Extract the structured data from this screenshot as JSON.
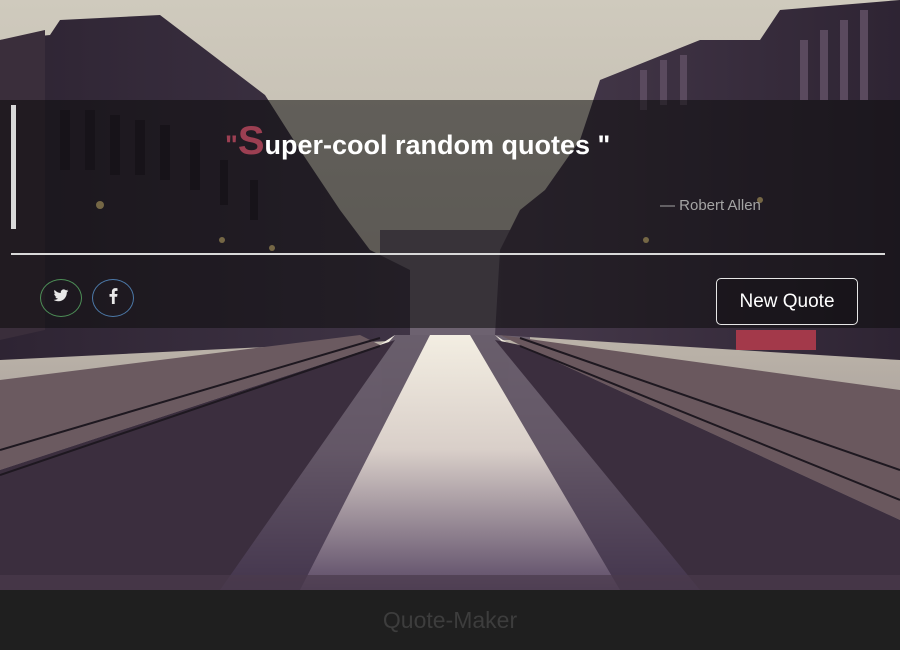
{
  "quote": {
    "open_mark": "\"",
    "first_letter": "S",
    "rest": "uper-cool random quotes \"",
    "author": "— Robert Allen"
  },
  "actions": {
    "twitter_icon": "twitter-icon",
    "facebook_icon": "facebook-icon",
    "twitter_glyph": "🐦",
    "facebook_glyph": "f",
    "new_quote_label": "New Quote"
  },
  "footer": {
    "title": "Quote-Maker"
  },
  "colors": {
    "accent": "#9c3f52",
    "twitter_ring": "#4d8f57",
    "facebook_ring": "#4c79a8"
  }
}
